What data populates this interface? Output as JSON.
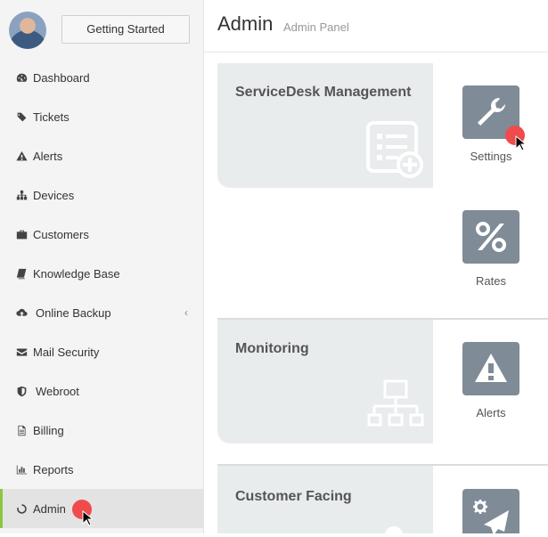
{
  "sidebar": {
    "getting_started": "Getting Started",
    "items": [
      {
        "label": "Dashboard",
        "icon": "tachometer-icon"
      },
      {
        "label": "Tickets",
        "icon": "tags-icon"
      },
      {
        "label": "Alerts",
        "icon": "warning-icon"
      },
      {
        "label": "Devices",
        "icon": "sitemap-icon"
      },
      {
        "label": "Customers",
        "icon": "briefcase-icon"
      },
      {
        "label": "Knowledge Base",
        "icon": "book-icon"
      },
      {
        "label": "Online Backup",
        "icon": "cloud-upload-icon",
        "has_submenu": true
      },
      {
        "label": "Mail Security",
        "icon": "envelope-icon"
      },
      {
        "label": "Webroot",
        "icon": "shield-icon"
      },
      {
        "label": "Billing",
        "icon": "file-text-icon"
      },
      {
        "label": "Reports",
        "icon": "bar-chart-icon"
      },
      {
        "label": "Admin",
        "icon": "circle-notch-icon",
        "active": true
      }
    ],
    "chevron": "‹"
  },
  "header": {
    "title": "Admin",
    "subtitle": "Admin Panel"
  },
  "sections": [
    {
      "title": "ServiceDesk Management",
      "icon": "form-add-icon"
    },
    {
      "title": "Monitoring",
      "icon": "network-icon"
    },
    {
      "title": "Customer Facing",
      "icon": "cloud-icon"
    }
  ],
  "tiles": [
    {
      "label": "Settings",
      "icon": "wrench-icon"
    },
    {
      "label": "Rates",
      "icon": "percent-icon"
    },
    {
      "label": "Alerts",
      "icon": "warning-icon"
    },
    {
      "label": "",
      "icon": "send-gear-icon"
    }
  ],
  "colors": {
    "accent": "#8cc63f",
    "tile": "#7f8b96",
    "card": "#e9eced",
    "cursor_dot": "#f04b4b"
  }
}
